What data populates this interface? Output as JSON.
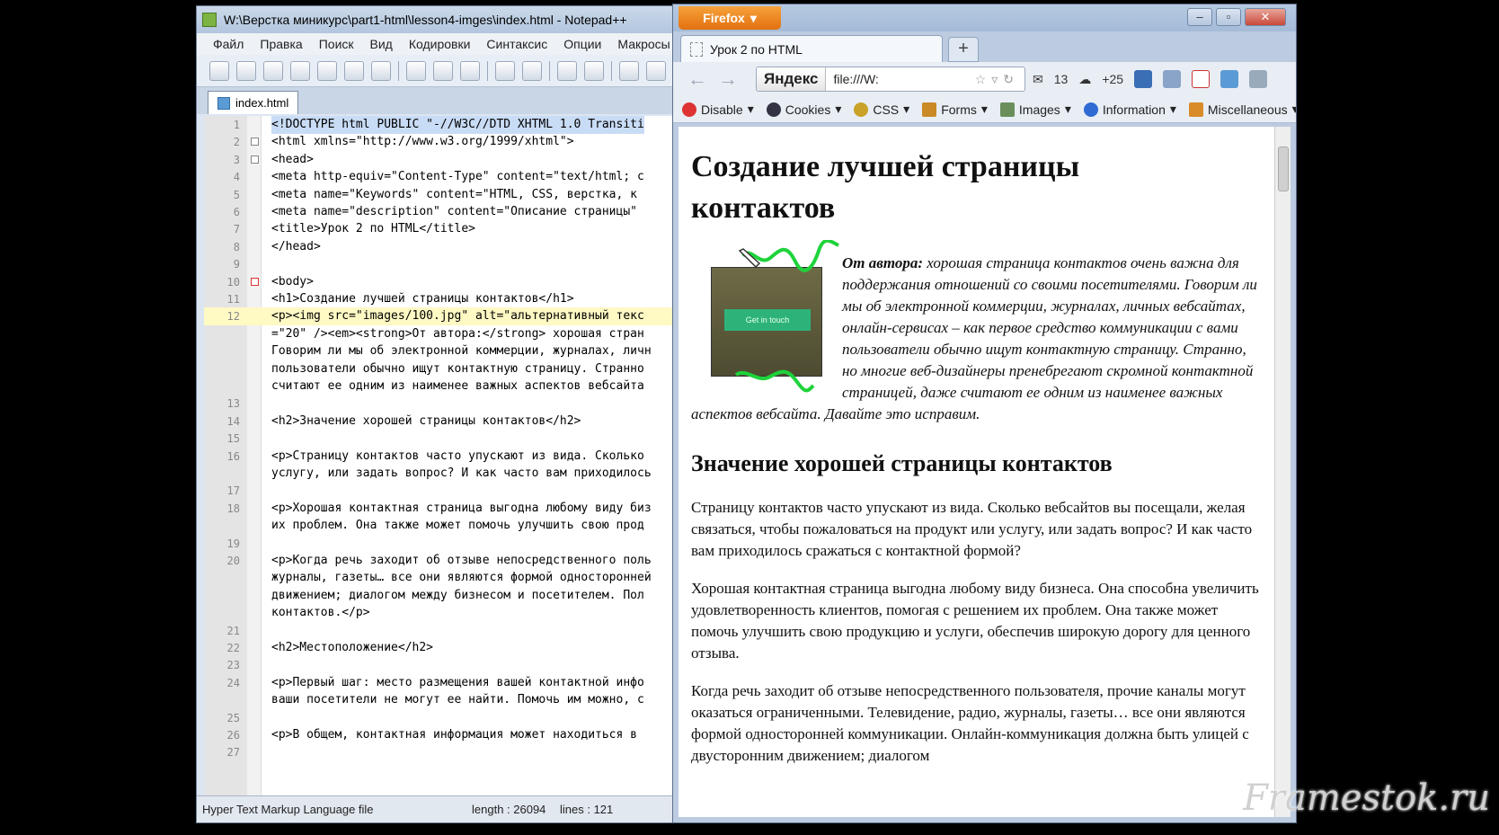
{
  "notepad": {
    "title": "W:\\Верстка миникурс\\part1-html\\lesson4-imges\\index.html - Notepad++",
    "menu": [
      "Файл",
      "Правка",
      "Поиск",
      "Вид",
      "Кодировки",
      "Синтаксис",
      "Опции",
      "Макросы"
    ],
    "tab_name": "index.html",
    "lines": [
      {
        "n": "1",
        "code": "<!DOCTYPE html PUBLIC \"-//W3C//DTD XHTML 1.0 Transiti"
      },
      {
        "n": "2",
        "code": "<html xmlns=\"http://www.w3.org/1999/xhtml\">"
      },
      {
        "n": "3",
        "code": "<head>"
      },
      {
        "n": "4",
        "code": "<meta http-equiv=\"Content-Type\" content=\"text/html; c"
      },
      {
        "n": "5",
        "code": "<meta name=\"Keywords\" content=\"HTML, CSS, верстка, к"
      },
      {
        "n": "6",
        "code": "<meta name=\"description\" content=\"Описание страницы\""
      },
      {
        "n": "7",
        "code": "<title>Урок 2 по HTML</title>"
      },
      {
        "n": "8",
        "code": "</head>"
      },
      {
        "n": "9",
        "code": ""
      },
      {
        "n": "10",
        "code": "<body>"
      },
      {
        "n": "11",
        "code": "<h1>Создание лучшей страницы контактов</h1>"
      },
      {
        "n": "12",
        "code": "<p><img src=\"images/100.jpg\" alt=\"альтернативный текс"
      },
      {
        "n": "",
        "code": "=\"20\" /><em><strong>От автора:</strong> хорошая стран"
      },
      {
        "n": "",
        "code": "Говорим ли мы об электронной коммерции, журналах, личн"
      },
      {
        "n": "",
        "code": "пользователи обычно ищут контактную страницу. Странно"
      },
      {
        "n": "",
        "code": "считают ее одним из наименее важных аспектов вебсайта"
      },
      {
        "n": "13",
        "code": ""
      },
      {
        "n": "14",
        "code": "<h2>Значение хорошей страницы контактов</h2>"
      },
      {
        "n": "15",
        "code": ""
      },
      {
        "n": "16",
        "code": "<p>Страницу контактов часто упускают из вида. Сколько"
      },
      {
        "n": "",
        "code": "услугу, или задать вопрос? И как часто вам приходилось"
      },
      {
        "n": "17",
        "code": ""
      },
      {
        "n": "18",
        "code": "<p>Хорошая контактная страница выгодна любому виду биз"
      },
      {
        "n": "",
        "code": "их проблем. Она также может помочь улучшить свою прод"
      },
      {
        "n": "19",
        "code": ""
      },
      {
        "n": "20",
        "code": "<p>Когда речь заходит об отзыве непосредственного поль"
      },
      {
        "n": "",
        "code": "журналы, газеты… все они являются формой односторонней"
      },
      {
        "n": "",
        "code": "движением; диалогом между бизнесом и посетителем. Пол"
      },
      {
        "n": "",
        "code": "контактов.</p>"
      },
      {
        "n": "21",
        "code": ""
      },
      {
        "n": "22",
        "code": "<h2>Местоположение</h2>"
      },
      {
        "n": "23",
        "code": ""
      },
      {
        "n": "24",
        "code": "<p>Первый шаг: место размещения вашей контактной инфо"
      },
      {
        "n": "",
        "code": "ваши посетители не могут ее найти. Помочь им можно, с"
      },
      {
        "n": "25",
        "code": ""
      },
      {
        "n": "26",
        "code": "<p>В общем, контактная информация может находиться в"
      },
      {
        "n": "27",
        "code": ""
      }
    ],
    "status": {
      "file_type": "Hyper Text Markup Language file",
      "length": "length : 26094",
      "lines": "lines : 121"
    }
  },
  "firefox": {
    "menu_button": "Firefox",
    "tab_title": "Урок 2 по HTML",
    "new_tab": "+",
    "search_engine": "Яндекс",
    "url": "file:///W:",
    "mail_count": "13",
    "weather": "+25",
    "devbar": [
      "Disable",
      "Cookies",
      "CSS",
      "Forms",
      "Images",
      "Information",
      "Miscellaneous"
    ],
    "page": {
      "h1": "Создание лучшей страницы контактов",
      "image_button": "Get in touch",
      "author_label": "От автора:",
      "author_text": " хорошая страница контактов очень важна для поддержания отношений со своими посетителями. Говорим ли мы об электронной коммерции, журналах, личных вебсайтах, онлайн-сервисах – как первое средство коммуникации с вами пользователи обычно ищут контактную страницу. Странно, но многие веб-дизайнеры пренебрегают скромной контактной страницей, даже считают ее одним из наименее важных аспектов вебсайта. Давайте это исправим.",
      "h2": "Значение хорошей страницы контактов",
      "paragraphs": [
        "Страницу контактов часто упускают из вида. Сколько вебсайтов вы посещали, желая связаться, чтобы пожаловаться на продукт или услугу, или задать вопрос? И как часто вам приходилось сражаться с контактной формой?",
        "Хорошая контактная страница выгодна любому виду бизнеса. Она способна увеличить удовлетворенность клиентов, помогая с решением их проблем. Она также может помочь улучшить свою продукцию и услуги, обеспечив широкую дорогу для ценного отзыва.",
        "Когда речь заходит об отзыве непосредственного пользователя, прочие каналы могут оказаться ограниченными. Телевидение, радио, журналы, газеты… все они являются формой односторонней коммуникации. Онлайн-коммуникация должна быть улицей с двусторонним движением; диалогом"
      ]
    }
  },
  "watermark": "Framestok.ru"
}
